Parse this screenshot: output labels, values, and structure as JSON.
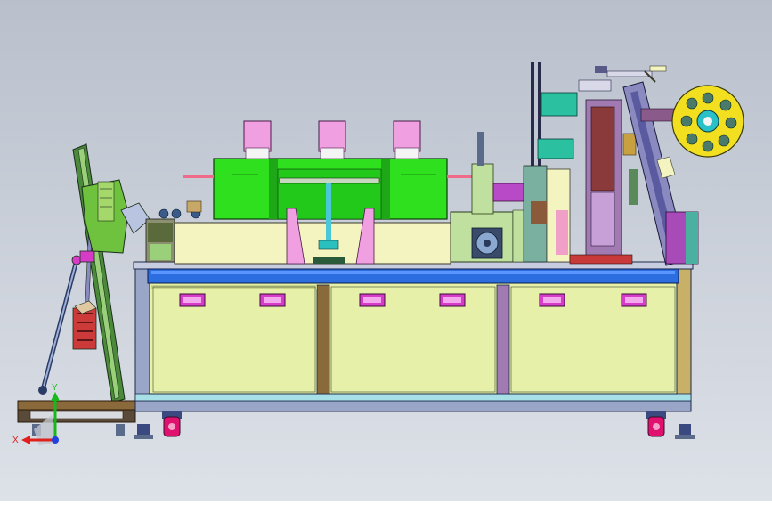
{
  "view": {
    "background_top": "#b9c0cc",
    "background_bottom": "#dde1e8"
  },
  "triad": {
    "x_label": "X",
    "y_label": "Y",
    "x_color": "#e0201c",
    "y_color": "#18b81c",
    "z_color": "#2040e0"
  },
  "machine": {
    "frame_color": "#9aa6c8",
    "top_plate_color": "#2c6ee0",
    "panel_color": "#e6f0a8",
    "handle_color": "#d63cc8",
    "heater_color": "#2ee01e",
    "cap_color": "#f0a0e0",
    "base_color": "#f4f4c0",
    "reel_color": "#f2e020",
    "mast_color": "#8a8ac0",
    "wheel_color": "#e0106e",
    "caster_color": "#3a4a80"
  }
}
